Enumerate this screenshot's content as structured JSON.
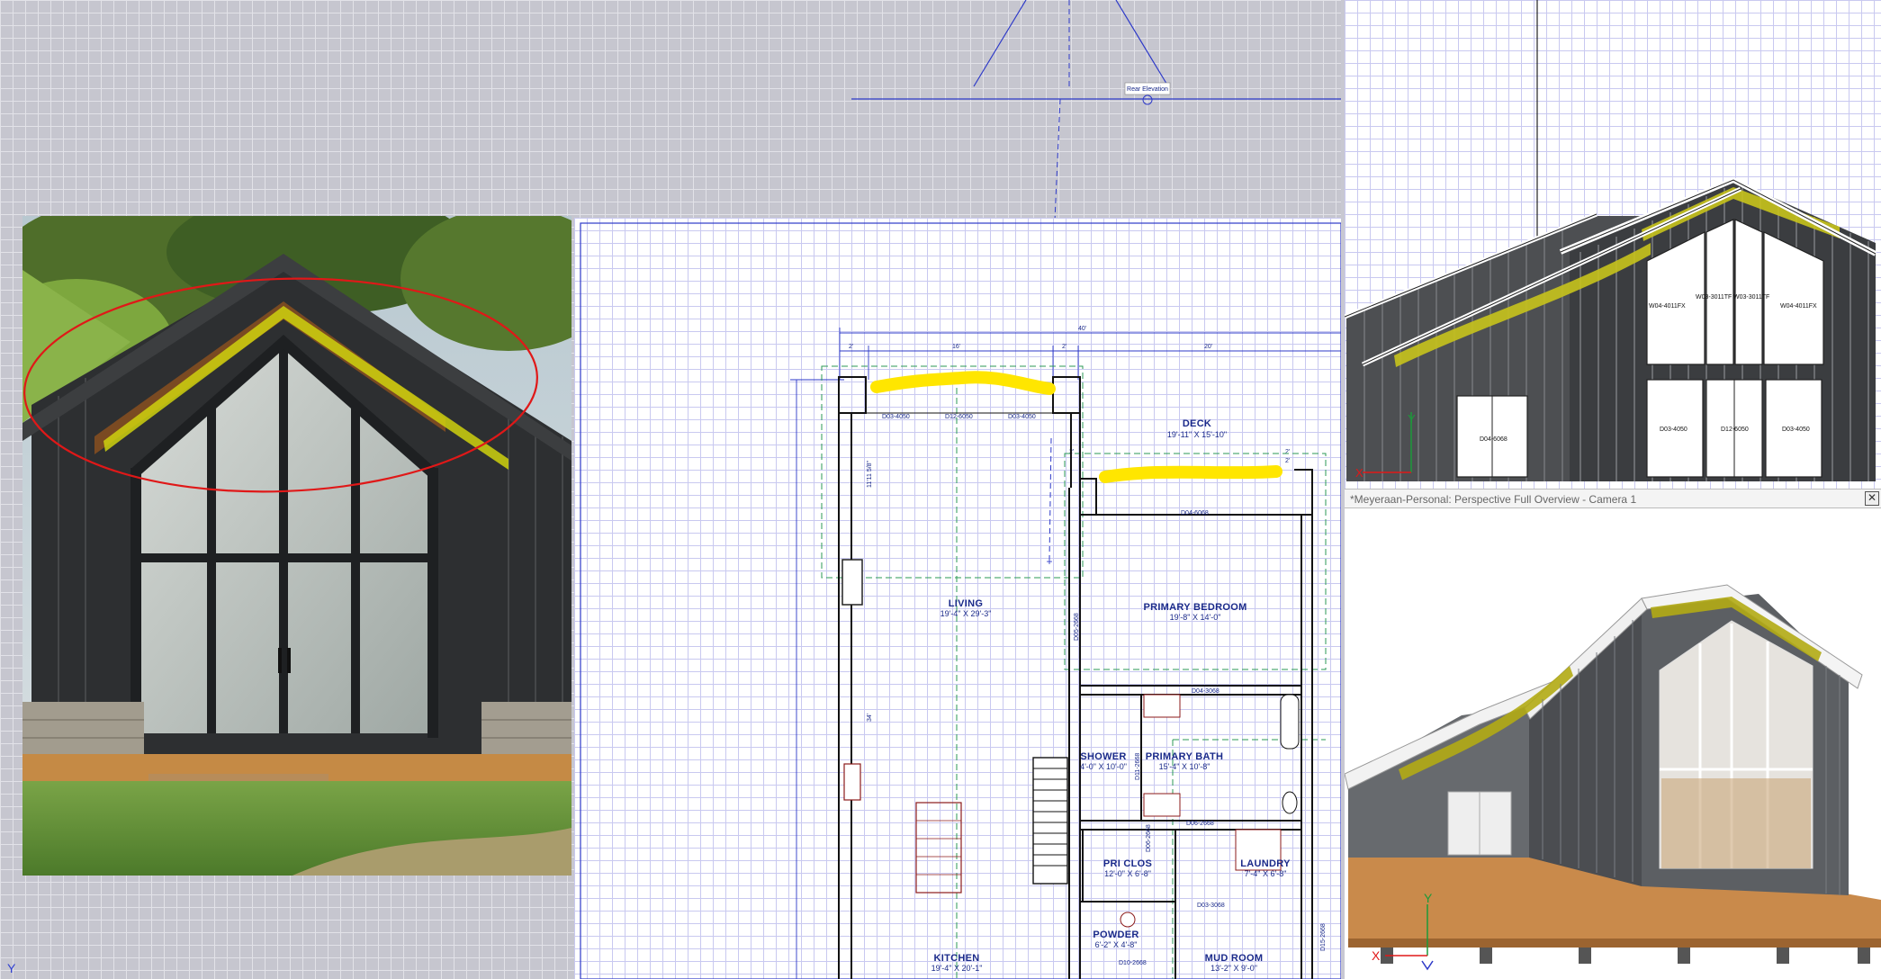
{
  "floorplan": {
    "dims": {
      "overall": "40'",
      "a": "2'",
      "b": "16'",
      "c": "2'",
      "d": "20'",
      "e": "2'",
      "f": "2'",
      "g": "2'",
      "h": "11'11 5/8\"",
      "left": "34'"
    },
    "rooms": [
      {
        "name": "DECK",
        "dim": "19'-11\" X 15'-10\""
      },
      {
        "name": "LIVING",
        "dim": "19'-4\" X 29'-3\""
      },
      {
        "name": "PRIMARY BEDROOM",
        "dim": "19'-8\" X 14'-0\""
      },
      {
        "name": "SHOWER",
        "dim": "4'-0\" X 10'-0\""
      },
      {
        "name": "PRIMARY BATH",
        "dim": "15'-4\" X 10'-8\""
      },
      {
        "name": "PRI CLOS",
        "dim": "12'-0\" X 6'-8\""
      },
      {
        "name": "LAUNDRY",
        "dim": "7'-4\" X 6'-8\""
      },
      {
        "name": "POWDER",
        "dim": "6'-2\" X 4'-8\""
      },
      {
        "name": "KITCHEN",
        "dim": "19'-4\" X 20'-1\""
      },
      {
        "name": "MUD ROOM",
        "dim": "13'-2\" X 9'-0\""
      }
    ],
    "tags": {
      "d1": "D03-4050",
      "d2": "D12-6050",
      "d3": "D03-4050",
      "d4": "D04-6068",
      "d5": "D04-3068",
      "d6": "D06-2668",
      "d7": "D03-3068",
      "d8": "D10-2668",
      "d9": "D05-2668",
      "d10": "D11-2668",
      "d11": "D06-2668",
      "d12": "D15-2668"
    },
    "elevation_marker": "Rear Elevation"
  },
  "elevation": {
    "windows": {
      "w1": "W04-4011FX",
      "w2": "W03-3011TF",
      "w3": "W03-3011TF",
      "w4": "W04-4011FX"
    },
    "doors": {
      "left": "D04-6068",
      "d1": "D03-4050",
      "d2": "D12-6050",
      "d3": "D03-4050"
    },
    "axis_y": "Y",
    "axis_x": "X"
  },
  "camera": {
    "title": "*Meyeraan-Personal: Perspective Full Overview - Camera 1",
    "close": "✕",
    "axis_y": "Y",
    "axis_x": "X"
  },
  "workspace": {
    "axis_y": "Y"
  },
  "colors": {
    "grid_line": "#c9c9f0",
    "plan_ink": "#1a2a8a",
    "highlight": "#ffe600",
    "annotation": "#e01818"
  }
}
